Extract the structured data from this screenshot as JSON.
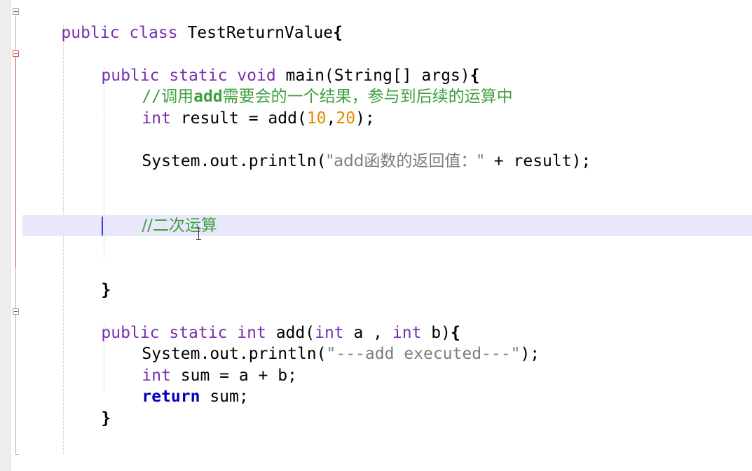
{
  "editor": {
    "lines": {
      "class_decl": {
        "kw1": "public",
        "kw2": "class",
        "name": " TestReturnValue",
        "brace": "{"
      },
      "main_decl": {
        "kw1": "public",
        "kw2": "static",
        "kw3": "void",
        "rest": " main(String[] args)",
        "brace": "{"
      },
      "comment1": {
        "slashes": "//",
        "pre": "调用",
        "bold": "add",
        "post": "需要会的一个结果，参与到后续的运算中"
      },
      "result_decl": {
        "type": "int",
        "rest1": " result = add(",
        "n1": "10",
        "comma": ",",
        "n2": "20",
        "rest2": ");"
      },
      "println1": {
        "pre": "System.out.println(",
        "str": "\"add函数的返回值：\"",
        "post": " + result);"
      },
      "comment2": {
        "text": "//二次运算"
      },
      "main_close": {
        "brace": "}"
      },
      "add_decl": {
        "kw1": "public",
        "kw2": "static",
        "type1": "int",
        "name": " add(",
        "type2": "int",
        "a": " a , ",
        "type3": "int",
        "b": " b)",
        "brace": "{"
      },
      "println2": {
        "pre": "System.out.println(",
        "str": "\"---add executed---\"",
        "post": ");"
      },
      "sum_decl": {
        "type": "int",
        "rest": " sum = a + b;"
      },
      "return_stmt": {
        "kw": "return",
        "rest": " sum;"
      },
      "add_close": {
        "brace": "}"
      },
      "class_close": {
        "brace": "}"
      }
    },
    "colors": {
      "keyword": "#7b2fb0",
      "return_keyword": "#0000c0",
      "string": "#7d7d7d",
      "number": "#e08a00",
      "comment": "#3f9f3f",
      "current_line": "#e8e8fa",
      "caret": "#3b3bd6"
    }
  }
}
